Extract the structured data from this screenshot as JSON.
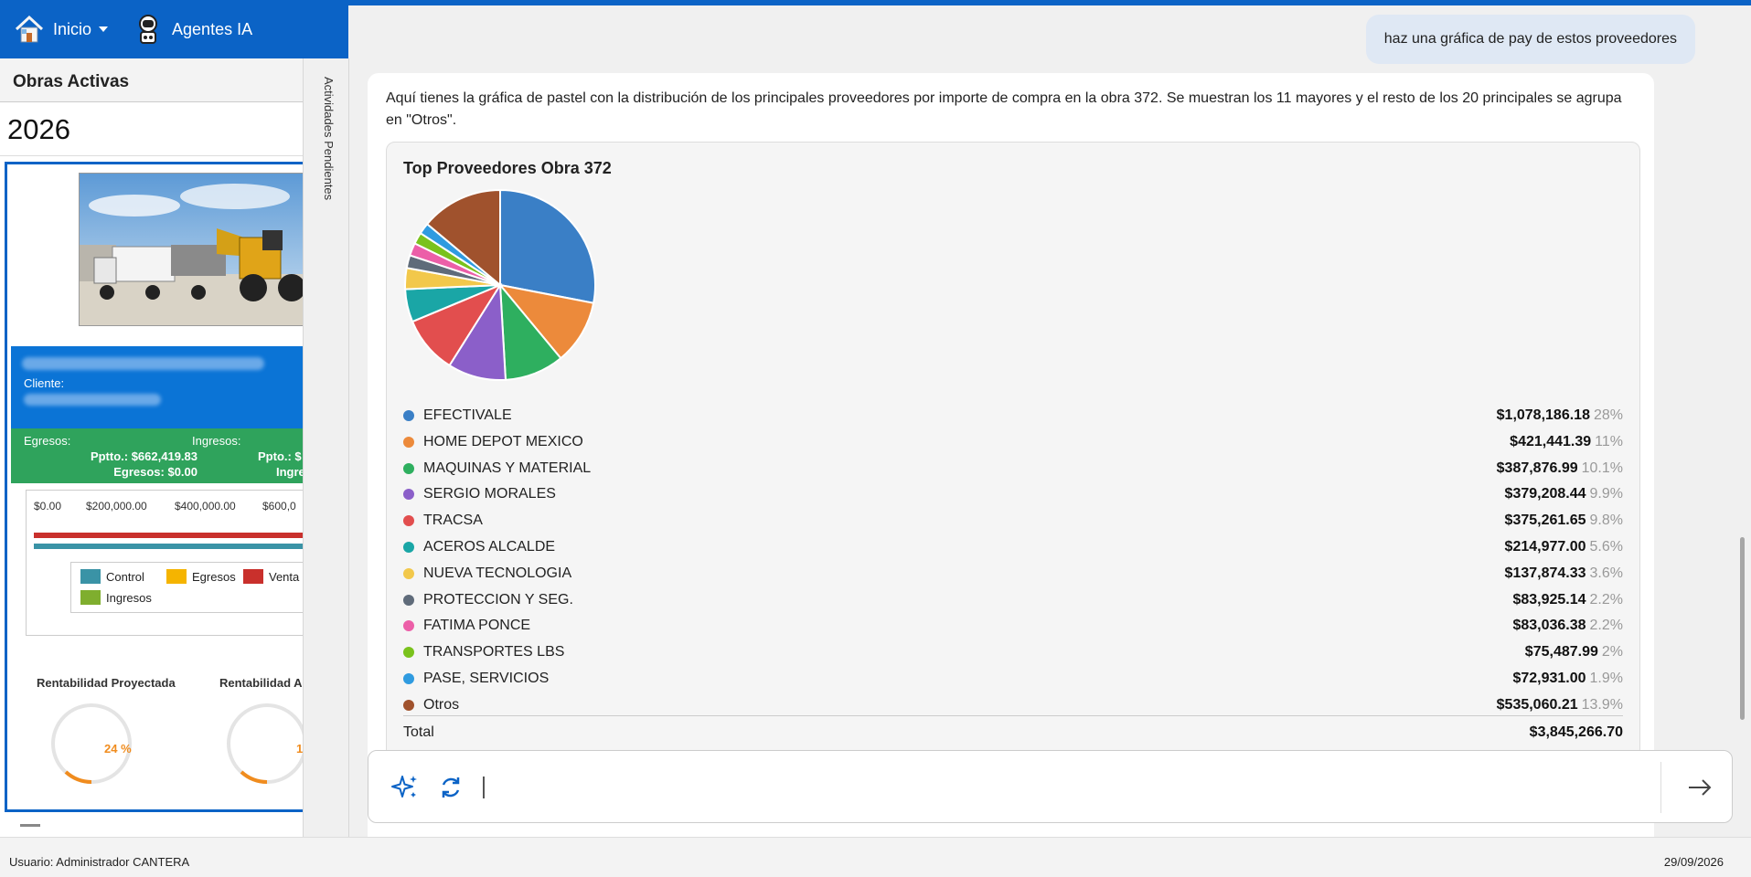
{
  "nav": {
    "home_label": "Inicio",
    "agents_label": "Agentes IA"
  },
  "left": {
    "title": "Obras Activas",
    "year": "2026",
    "card": {
      "cliente_label": "Cliente:",
      "egresos_label": "Egresos:",
      "ingresos_label": "Ingresos:",
      "ppto_left": "Pptto.: $662,419.83",
      "egresos_left": "Egresos: $0.00",
      "ppto_right": "Ppto.: $",
      "ingresos_right": "Ingre",
      "axis_ticks": [
        "$0.00",
        "$200,000.00",
        "$400,000.00",
        "$600,0"
      ],
      "legend": [
        "Control",
        "Egresos",
        "Venta",
        "Ingresos"
      ],
      "rent_proyectada_label": "Rentabilidad Proyectada",
      "rent_actual_label": "Rentabilidad A",
      "rent_proyectada_value": "24 %",
      "rent_actual_value": "1",
      "rent_proyectada_fraction": 0.24,
      "colors": {
        "control": "#3a93a6",
        "egresos": "#f5b400",
        "venta": "#c9302c",
        "ingresos": "#7fae2e"
      }
    }
  },
  "side_tab": {
    "label": "Actividades Pendientes"
  },
  "chat": {
    "user_message": "haz una gráfica de pay de estos proveedores",
    "answer_text": "Aquí tienes la gráfica de pastel con la distribución de los principales proveedores por importe de compra en la obra 372. Se muestran los 11 mayores y el resto de los 20 principales se agrupa en \"Otros\".",
    "total_label": "Total",
    "total_value": "$3,845,266.70"
  },
  "chart_data": {
    "type": "pie",
    "title": "Top Proveedores Obra 372",
    "slices": [
      {
        "label": "EFECTIVALE",
        "value": 1078186.18,
        "display": "$1,078,186.18",
        "pct": "28%",
        "color": "#3a7fc6"
      },
      {
        "label": "HOME DEPOT MEXICO",
        "value": 421441.39,
        "display": "$421,441.39",
        "pct": "11%",
        "color": "#ec8a3b"
      },
      {
        "label": "MAQUINAS Y MATERIAL",
        "value": 387876.99,
        "display": "$387,876.99",
        "pct": "10.1%",
        "color": "#2eaf5f"
      },
      {
        "label": "SERGIO MORALES",
        "value": 379208.44,
        "display": "$379,208.44",
        "pct": "9.9%",
        "color": "#8b5fc9"
      },
      {
        "label": "TRACSA",
        "value": 375261.65,
        "display": "$375,261.65",
        "pct": "9.8%",
        "color": "#e24e4e"
      },
      {
        "label": "ACEROS ALCALDE",
        "value": 214977.0,
        "display": "$214,977.00",
        "pct": "5.6%",
        "color": "#1aa6a6"
      },
      {
        "label": "NUEVA TECNOLOGIA",
        "value": 137874.33,
        "display": "$137,874.33",
        "pct": "3.6%",
        "color": "#f2c84b"
      },
      {
        "label": "PROTECCION Y SEG.",
        "value": 83925.14,
        "display": "$83,925.14",
        "pct": "2.2%",
        "color": "#5f6b7a"
      },
      {
        "label": "FATIMA PONCE",
        "value": 83036.38,
        "display": "$83,036.38",
        "pct": "2.2%",
        "color": "#ec5fa8"
      },
      {
        "label": "TRANSPORTES LBS",
        "value": 75487.99,
        "display": "$75,487.99",
        "pct": "2%",
        "color": "#7ac21c"
      },
      {
        "label": "PASE, SERVICIOS",
        "value": 72931.0,
        "display": "$72,931.00",
        "pct": "1.9%",
        "color": "#2f9be0"
      },
      {
        "label": "Otros",
        "value": 535060.21,
        "display": "$535,060.21",
        "pct": "13.9%",
        "color": "#a0522d"
      }
    ]
  },
  "status": {
    "user": "Usuario: Administrador CANTERA",
    "date": "29/09/2026"
  }
}
